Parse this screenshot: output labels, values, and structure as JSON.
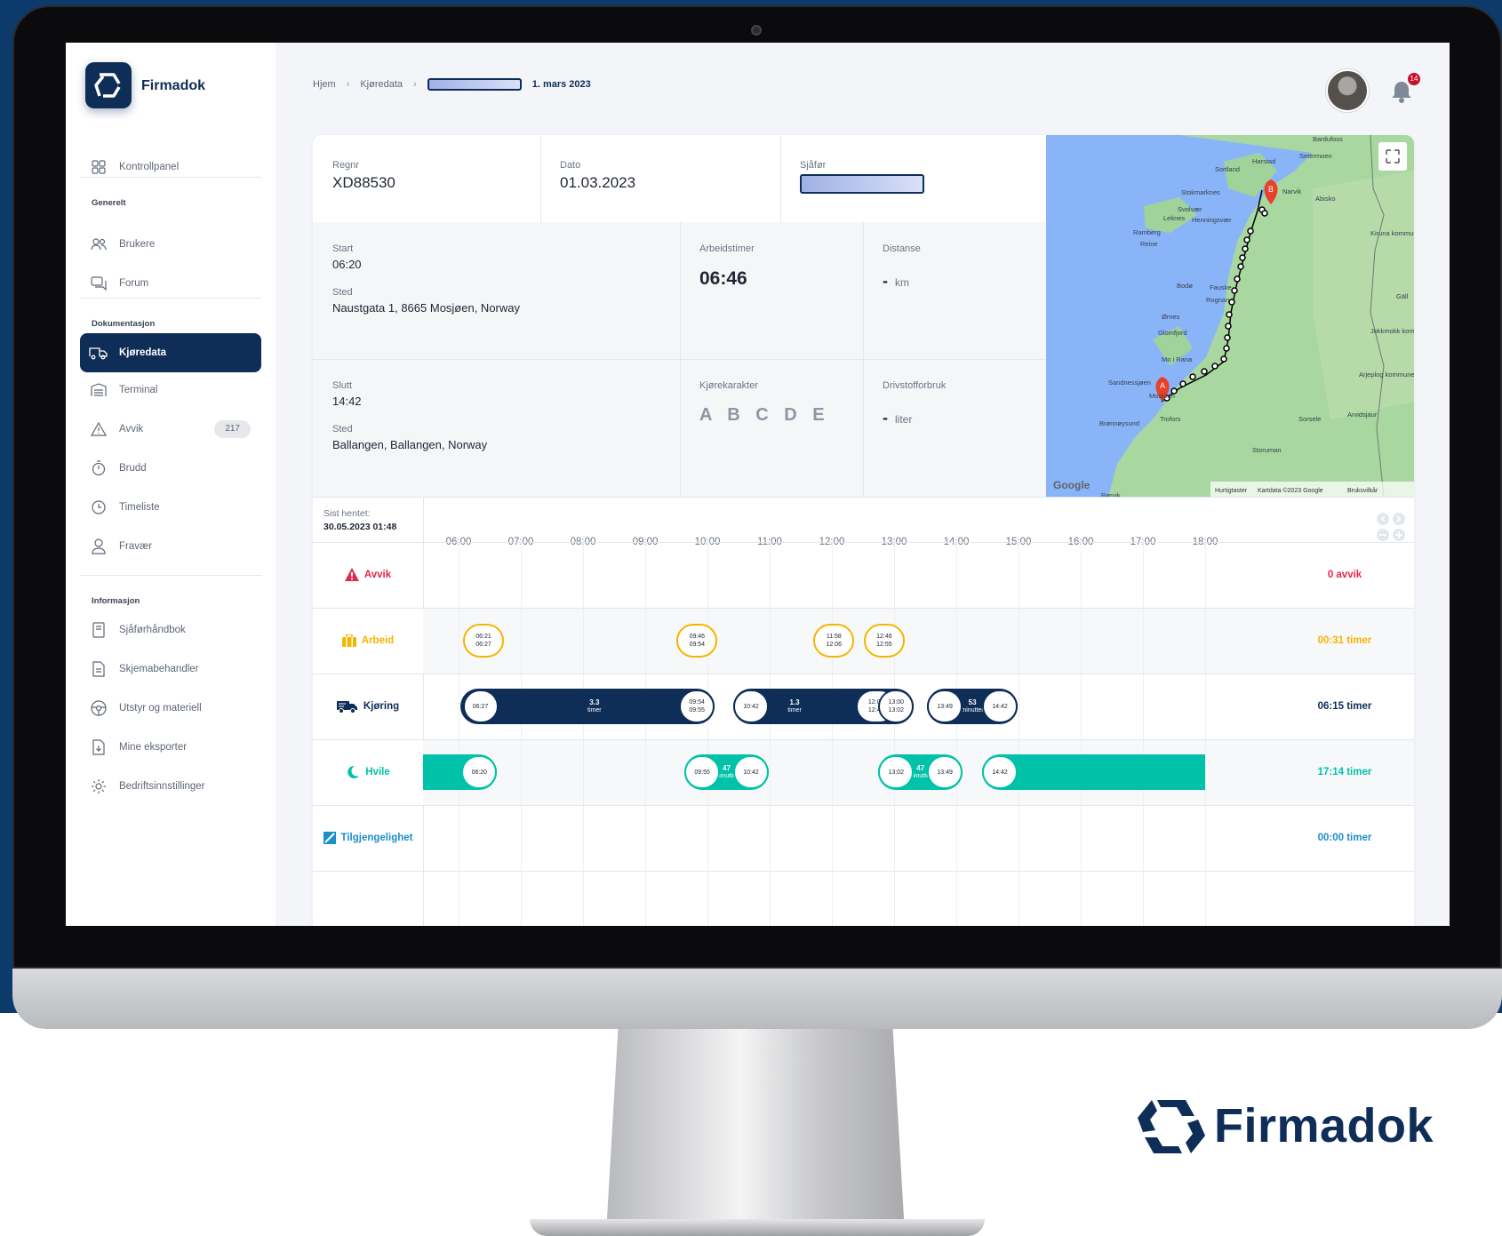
{
  "brand": {
    "name": "Firmadok",
    "app_name": "Firmadok"
  },
  "colors": {
    "navy": "#0e2d57",
    "teal": "#00c2a8",
    "amber": "#f5b400",
    "red": "#e8254a",
    "sky": "#1e8ec9"
  },
  "sidebar": {
    "top_item": {
      "label": "Kontrollpanel",
      "icon": "dashboard-icon"
    },
    "sections": [
      {
        "title": "Generelt",
        "items": [
          {
            "label": "Brukere",
            "icon": "users-icon"
          },
          {
            "label": "Forum",
            "icon": "chat-icon"
          }
        ]
      },
      {
        "title": "Dokumentasjon",
        "items": [
          {
            "label": "Kjøredata",
            "icon": "truck-icon",
            "active": true
          },
          {
            "label": "Terminal",
            "icon": "terminal-icon"
          },
          {
            "label": "Avvik",
            "icon": "warning-icon",
            "badge": "217"
          },
          {
            "label": "Brudd",
            "icon": "stopwatch-icon"
          },
          {
            "label": "Timeliste",
            "icon": "clock-icon"
          },
          {
            "label": "Fravær",
            "icon": "person-icon"
          }
        ]
      },
      {
        "title": "Informasjon",
        "items": [
          {
            "label": "Sjåførhåndbok",
            "icon": "book-icon"
          },
          {
            "label": "Skjemabehandler",
            "icon": "form-icon"
          },
          {
            "label": "Utstyr og materiell",
            "icon": "steering-wheel-icon"
          },
          {
            "label": "Mine eksporter",
            "icon": "export-icon"
          },
          {
            "label": "Bedriftsinnstillinger",
            "icon": "gear-icon"
          }
        ]
      }
    ]
  },
  "breadcrumb": {
    "home": "Hjem",
    "section": "Kjøredata",
    "current": "1. mars 2023"
  },
  "notifications": {
    "count": "14"
  },
  "trip": {
    "regnr_label": "Regnr",
    "regnr": "XD88530",
    "date_label": "Dato",
    "date": "01.03.2023",
    "driver_label": "Sjåfør",
    "start_label": "Start",
    "start_time": "06:20",
    "start_place_label": "Sted",
    "start_place": "Naustgata 1, 8665 Mosjøen, Norway",
    "end_label": "Slutt",
    "end_time": "14:42",
    "end_place_label": "Sted",
    "end_place": "Ballangen, Ballangen, Norway",
    "work_hours_label": "Arbeidstimer",
    "work_hours": "06:46",
    "distance_label": "Distanse",
    "distance": "-",
    "distance_unit": "km",
    "grade_label": "Kjørekarakter",
    "grades": "A B C D E",
    "fuel_label": "Drivstofforbruk",
    "fuel": "-",
    "fuel_unit": "liter"
  },
  "map": {
    "places": [
      "Bardufoss",
      "Harstad",
      "Setermoen",
      "Sortland",
      "Stokmarknes",
      "Narvik",
      "Abisko",
      "Svolvær",
      "Henningsvær",
      "Leknes",
      "Ramberg",
      "Reine",
      "Kiruna kommun",
      "Bodø",
      "Fauske",
      "Gäll",
      "Rognan",
      "Ørnes",
      "Glomfjord",
      "Jokkmokk kommune",
      "Mo i Rana",
      "Sandnessjøen",
      "Arjeplog kommune",
      "Mosjøen",
      "Arvidsjaur",
      "Trofors",
      "Brønnøysund",
      "Sorsele",
      "Storuman",
      "Rørvik"
    ],
    "marker_start": "A",
    "marker_end": "B",
    "footer": [
      "Hurtigtaster",
      "Kartdata ©2023 Google",
      "Bruksvilkår"
    ],
    "attribution": "Google"
  },
  "timeline": {
    "last_fetched_label": "Sist hentet:",
    "last_fetched": "30.05.2023 01:48",
    "hours": [
      "06:00",
      "07:00",
      "08:00",
      "09:00",
      "10:00",
      "11:00",
      "12:00",
      "13:00",
      "14:00",
      "15:00",
      "16:00",
      "17:00",
      "18:00"
    ],
    "rows": [
      {
        "label": "Avvik",
        "total": "0 avvik"
      },
      {
        "label": "Arbeid",
        "total": "00:31 timer"
      },
      {
        "label": "Kjøring",
        "total": "06:15 timer"
      },
      {
        "label": "Hvile",
        "total": "17:14 timer"
      },
      {
        "label": "Tilgjengelighet",
        "total": "00:00 timer"
      }
    ],
    "work": [
      {
        "start": "06:21",
        "end": "06:27"
      },
      {
        "start": "09:46",
        "end": "09:54"
      },
      {
        "start": "11:58",
        "end": "12:06"
      },
      {
        "start": "12:46",
        "end": "12:55"
      }
    ],
    "driving": [
      {
        "start": "06:27",
        "end_a": "09:54",
        "end_b": "09:55",
        "duration": "3.3",
        "unit": "timer"
      },
      {
        "start": "10:42",
        "end_a": "12:06",
        "end_b": "12:46",
        "duration": "1.3",
        "unit": "timer",
        "end2_a": "13:00",
        "end2_b": "13:02"
      },
      {
        "start": "13:49",
        "end": "14:42",
        "duration": "53",
        "unit": "minutter"
      }
    ],
    "rest": [
      {
        "end": "06:20"
      },
      {
        "start": "09:55",
        "end": "10:42",
        "duration": "47",
        "unit": "minutter"
      },
      {
        "start": "13:02",
        "end": "13:49",
        "duration": "47",
        "unit": "minutter"
      },
      {
        "start": "14:42"
      }
    ]
  }
}
